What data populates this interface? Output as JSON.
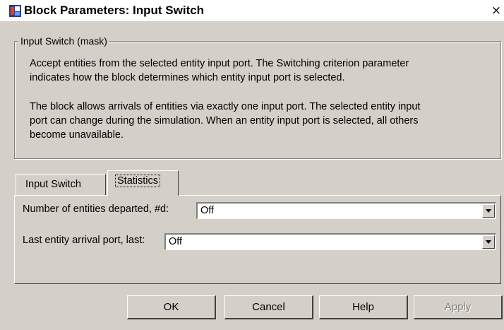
{
  "window": {
    "title": "Block Parameters: Input Switch",
    "close_glyph": "×",
    "icon": "simulink-block-icon"
  },
  "mask": {
    "group_label": "Input Switch  (mask)",
    "paragraph1_line1": "Accept entities from the selected entity input port. The Switching criterion parameter",
    "paragraph1_line2": "indicates how the block determines which entity input port is selected.",
    "paragraph2_line1": "The block allows arrivals of entities via exactly one input port. The selected entity input",
    "paragraph2_line2": "port can change during the simulation. When an entity input port is selected, all others",
    "paragraph2_line3": "become unavailable."
  },
  "tabs": [
    {
      "label": "Input Switch",
      "active": false
    },
    {
      "label": "Statistics",
      "active": true
    }
  ],
  "statistics": {
    "departed_label": "Number of entities departed, #d:",
    "departed_value": "Off",
    "last_port_label": "Last entity arrival port, last:",
    "last_port_value": "Off"
  },
  "buttons": {
    "ok": "OK",
    "cancel": "Cancel",
    "help": "Help",
    "apply": "Apply"
  },
  "colors": {
    "dialog_face": "#d4d0c8",
    "title_bar": "#ffffff"
  }
}
